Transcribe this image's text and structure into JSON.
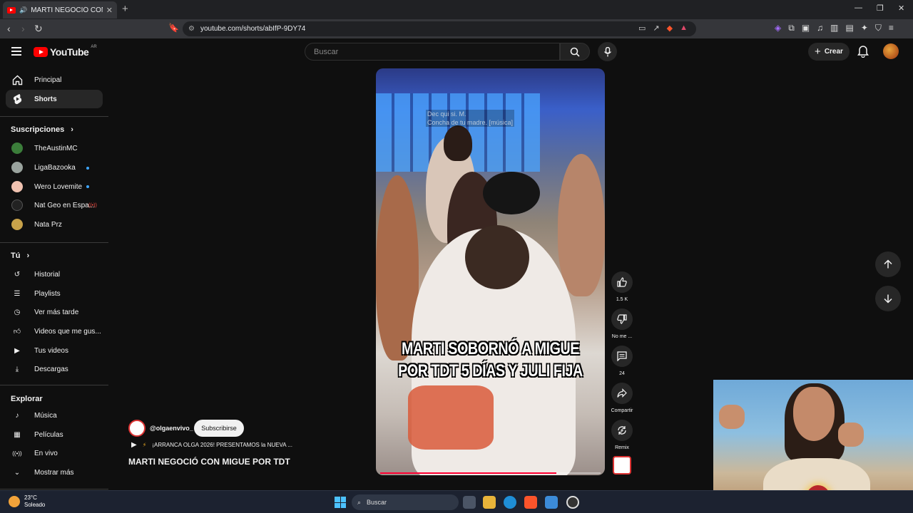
{
  "browser": {
    "tab_title": "MARTI NEGOCIÓ CON MIGUE",
    "tab_audio_icon": "speaker-icon",
    "url": "youtube.com/shorts/abIfP-9DY74"
  },
  "header": {
    "logo_text": "YouTube",
    "country": "AR",
    "search_placeholder": "Buscar",
    "create_label": "Crear"
  },
  "sidebar": {
    "main": [
      {
        "label": "Principal",
        "icon": "home-icon"
      },
      {
        "label": "Shorts",
        "icon": "shorts-icon"
      }
    ],
    "subscriptions_title": "Suscripciones",
    "subscriptions": [
      {
        "label": "TheAustinMC",
        "color": "#3b7d3a"
      },
      {
        "label": "LigaBazooka",
        "color": "#9aa39e"
      },
      {
        "label": "Wero Lovemite",
        "color": "#f0c2b0"
      },
      {
        "label": "Nat Geo en Espa...",
        "color": "#222222"
      },
      {
        "label": "Nata Prz",
        "color": "#c8a24a"
      }
    ],
    "you_title": "Tú",
    "you": [
      {
        "label": "Historial",
        "icon": "history-icon"
      },
      {
        "label": "Playlists",
        "icon": "playlist-icon"
      },
      {
        "label": "Ver más tarde",
        "icon": "clock-icon"
      },
      {
        "label": "Videos que me gus...",
        "icon": "thumbs-up-icon"
      },
      {
        "label": "Tus videos",
        "icon": "video-icon"
      },
      {
        "label": "Descargas",
        "icon": "download-icon"
      }
    ],
    "explore_title": "Explorar",
    "explore": [
      {
        "label": "Música",
        "icon": "music-icon"
      },
      {
        "label": "Películas",
        "icon": "film-icon"
      },
      {
        "label": "En vivo",
        "icon": "live-icon"
      },
      {
        "label": "Mostrar más",
        "icon": "chevron-down-icon"
      }
    ]
  },
  "short": {
    "overlay_caption": [
      "Dec qui si. M.",
      "Concha de tu madre. [música]"
    ],
    "title_lines": [
      "MARTI SOBORNÓ A MIGUE",
      "POR TDT 5 DÍAS Y JULI FIJA"
    ],
    "progress_fraction": 0.8,
    "channel": "@olgaenvivo_",
    "subscribe_label": "Subscribirse",
    "music_line": "¡ARRANCA OLGA 2026! PRESENTAMOS la NUEVA ...",
    "caption": "MARTI NEGOCIÓ CON MIGUE POR TDT"
  },
  "actions": {
    "like_count": "1.5 K",
    "dislike_label": "No me ...",
    "comments_count": "24",
    "share_label": "Compartir",
    "remix_label": "Remix"
  },
  "taskbar": {
    "temperature": "23°C",
    "condition": "Soleado",
    "search_label": "Buscar"
  },
  "colors": {
    "accent": "#ff0000",
    "background": "#0f0f0f",
    "subscription_dot": "#3ea6ff"
  }
}
